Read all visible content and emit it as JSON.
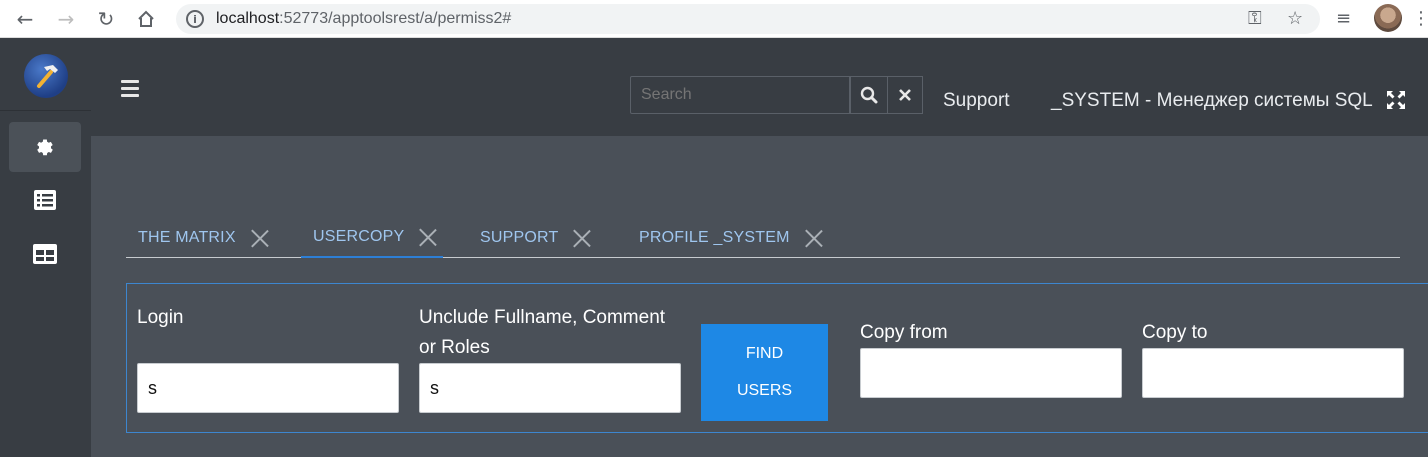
{
  "browser": {
    "url_host": "localhost",
    "url_rest": ":52773/apptoolsrest/a/permiss2#"
  },
  "topbar": {
    "search_placeholder": "Search",
    "support_link": "Support",
    "user_label": "_SYSTEM - Менеджер системы SQL"
  },
  "sidebar": {
    "items": [
      {
        "icon": "gear-icon",
        "active": true
      },
      {
        "icon": "list-icon",
        "active": false
      },
      {
        "icon": "table-icon",
        "active": false
      }
    ]
  },
  "tabs": [
    {
      "label": "THE MATRIX",
      "active": false
    },
    {
      "label": "USERCOPY",
      "active": true
    },
    {
      "label": "SUPPORT",
      "active": false
    },
    {
      "label": "PROFILE _SYSTEM",
      "active": false
    }
  ],
  "form": {
    "login_label": "Login",
    "login_value": "s",
    "include_label_line1": "Unclude Fullname, Comment",
    "include_label_line2": "or Roles",
    "include_value": "s",
    "find_line1": "FIND",
    "find_line2": "USERS",
    "copy_from_label": "Copy from",
    "copy_from_value": "",
    "copy_to_label": "Copy to",
    "copy_to_value": ""
  },
  "colors": {
    "accent": "#1e88e5",
    "tab_text": "#9fc6ef",
    "panel_border": "#3d86cf",
    "background": "#4a5058",
    "sidebar": "#383d43"
  }
}
